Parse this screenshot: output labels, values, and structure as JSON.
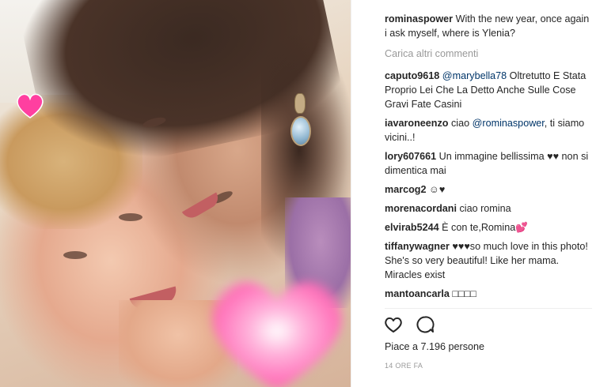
{
  "post": {
    "caption": {
      "user": "rominaspower",
      "text": " With the new year, once again i ask myself, where is Ylenia?"
    },
    "load_more": "Carica altri commenti",
    "comments": [
      {
        "user": "caputo9618",
        "mention": "@marybella78",
        "text": " Oltretutto E Stata Proprio Lei Che La Detto Anche Sulle Cose Gravi Fate Casini"
      },
      {
        "user": "iavaroneenzo",
        "pre": " ciao ",
        "mention": "@rominaspower",
        "text": ", ti siamo vicini..!"
      },
      {
        "user": "lory607661",
        "text": " Un immagine bellissima ♥♥ non si dimentica mai"
      },
      {
        "user": "marcog2",
        "text": " ☺♥"
      },
      {
        "user": "morenacordani",
        "text": " ciao romina"
      },
      {
        "user": "elvirab5244",
        "text": " È con te,Romina💕"
      },
      {
        "user": "tiffanywagner",
        "text": " ♥♥♥so much love in this photo! She's so very beautiful! Like her mama. Miracles exist"
      },
      {
        "user": "mantoancarla",
        "text": " □□□□"
      }
    ],
    "likes": "Piace a 7.196 persone",
    "time": "14 ORE FA"
  },
  "icons": {
    "like": "heart-outline-icon",
    "comment": "speech-bubble-icon",
    "sticker_small": "pink-heart-icon",
    "sticker_big": "pink-heart-blurred-icon"
  },
  "colors": {
    "text": "#262626",
    "muted": "#999999",
    "mention": "#003569",
    "heart_pink": "#ff4fa3"
  }
}
